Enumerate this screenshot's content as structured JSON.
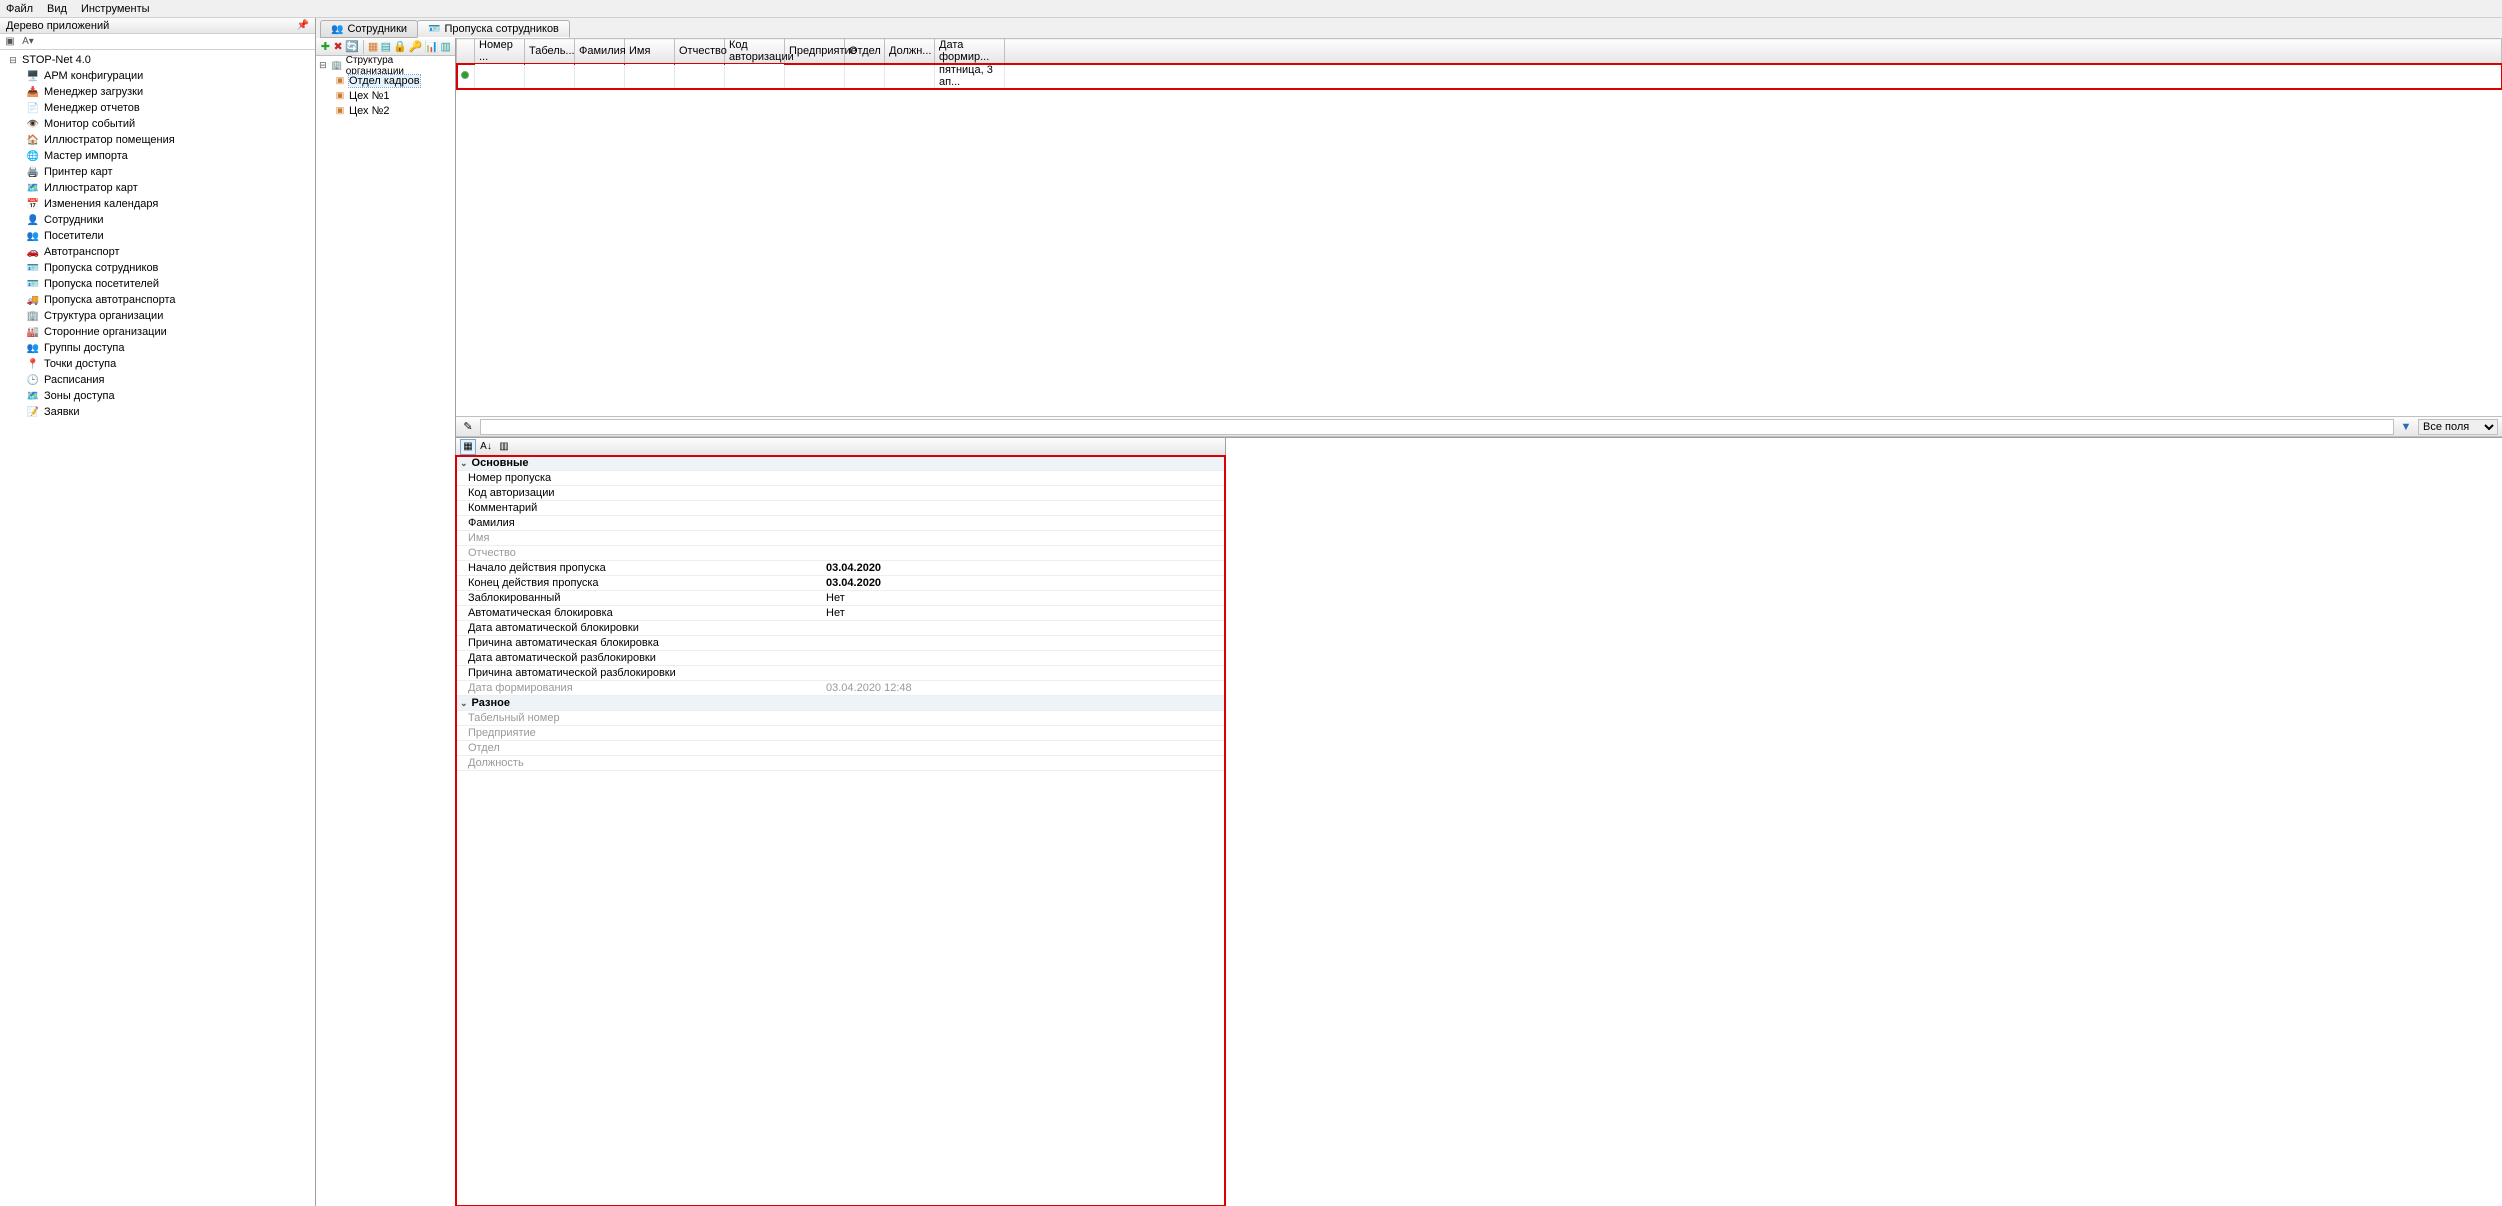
{
  "menu": {
    "file": "Файл",
    "view": "Вид",
    "tools": "Инструменты"
  },
  "left_panel": {
    "title": "Дерево приложений",
    "font_size_label": "A▾"
  },
  "app_tree": {
    "root": "STOP-Net 4.0",
    "items": [
      "АРМ конфигурации",
      "Менеджер загрузки",
      "Менеджер отчетов",
      "Монитор событий",
      "Иллюстратор помещения",
      "Мастер импорта",
      "Принтер карт",
      "Иллюстратор карт",
      "Изменения календаря",
      "Сотрудники",
      "Посетители",
      "Автотранспорт",
      "Пропуска сотрудников",
      "Пропуска посетителей",
      "Пропуска автотранспорта",
      "Структура организации",
      "Сторонние организации",
      "Группы доступа",
      "Точки доступа",
      "Расписания",
      "Зоны доступа",
      "Заявки"
    ]
  },
  "tabs": {
    "employees": "Сотрудники",
    "passes": "Пропуска сотрудников"
  },
  "org_tree": {
    "root": "Структура организации",
    "dept": "Отдел кадров",
    "shop1": "Цех №1",
    "shop2": "Цех №2"
  },
  "grid": {
    "columns": [
      "",
      "Номер ...",
      "Табель...",
      "Фамилия",
      "Имя",
      "Отчество",
      "Код авторизации",
      "Предприятие",
      "Отдел",
      "Должн...",
      "Дата формир..."
    ],
    "row": {
      "date": "пятница, 3 ап..."
    }
  },
  "filter": {
    "all_fields": "Все поля",
    "placeholder": ""
  },
  "props": {
    "cat_main": "Основные",
    "pass_number": "Номер пропуска",
    "auth_code": "Код авторизации",
    "comment": "Комментарий",
    "surname": "Фамилия",
    "name": "Имя",
    "patronymic": "Отчество",
    "start_date": "Начало действия пропуска",
    "start_date_val": "03.04.2020",
    "end_date": "Конец действия пропуска",
    "end_date_val": "03.04.2020",
    "blocked": "Заблокированный",
    "blocked_val": "Нет",
    "autoblock": "Автоматическая блокировка",
    "autoblock_val": "Нет",
    "autoblock_date": "Дата автоматической блокировки",
    "autoblock_reason": "Причина автоматическая блокировка",
    "autounblock_date": "Дата автоматической разблокировки",
    "autounblock_reason": "Причина автоматической разблокировки",
    "form_date": "Дата формирования",
    "form_date_val": "03.04.2020 12:48",
    "cat_misc": "Разное",
    "tab_num": "Табельный номер",
    "enterprise": "Предприятие",
    "dept": "Отдел",
    "position": "Должность"
  }
}
